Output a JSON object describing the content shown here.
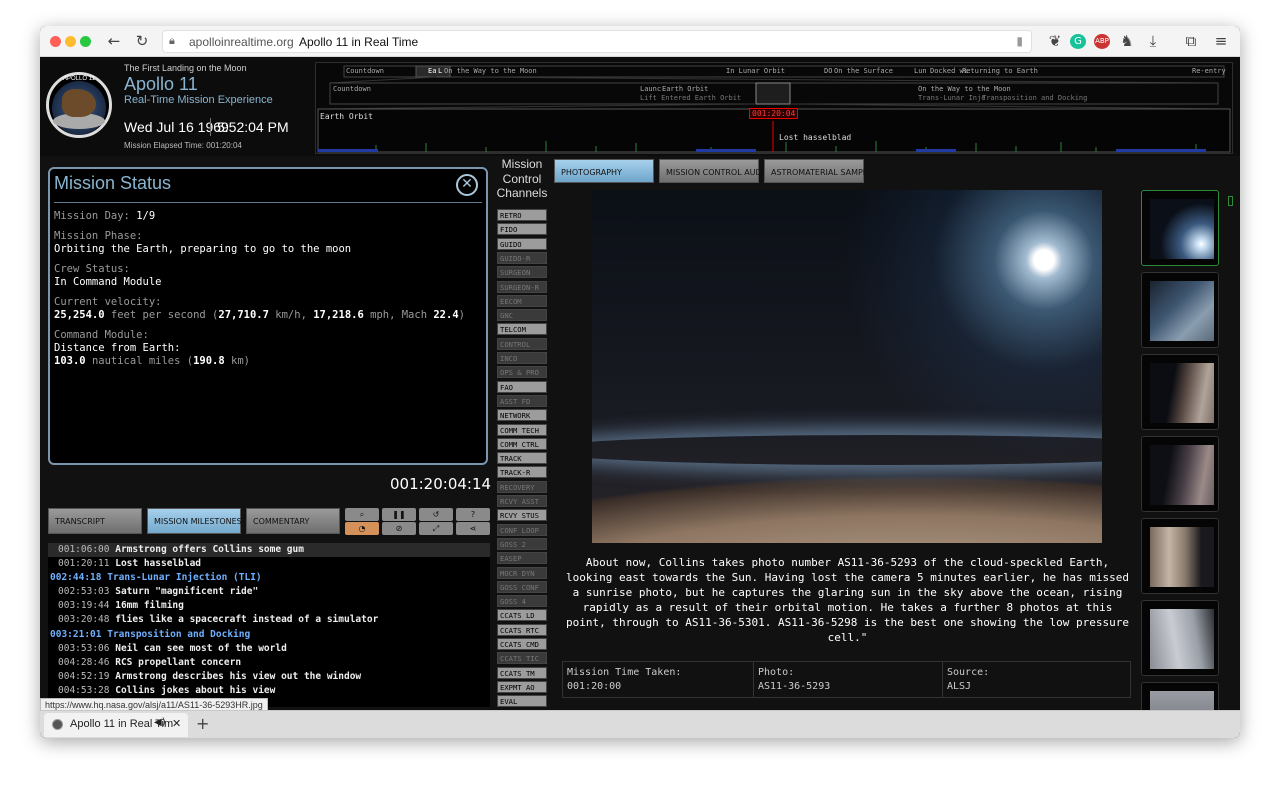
{
  "browser": {
    "domain": "apolloinrealtime.org",
    "page_title": "Apollo 11 in Real Time",
    "tab_title": "Apollo 11 in Real Tim",
    "status_url": "https://www.hq.nasa.gov/alsj/a11/AS11-36-5293HR.jpg",
    "colors": {
      "close": "#fe5f57",
      "minimize": "#febc2e",
      "zoom": "#28c840"
    }
  },
  "header": {
    "subtitle": "The First Landing on the Moon",
    "title": "Apollo 11",
    "tagline": "Real-Time Mission Experience",
    "date": "Wed Jul 16 1969",
    "time": "5:52:04 PM",
    "met_label": "Mission Elapsed Time: 001:20:04",
    "logo_text": "APOLLO 11"
  },
  "timeline": {
    "row1": [
      "Countdown",
      "Ea",
      "L",
      "On the Way to the Moon",
      "In Lunar Orbit",
      "DO",
      "On the Surface",
      "Lun",
      "Docked wi",
      "Returning to Earth",
      "Re-entry"
    ],
    "row2": [
      "Countdown",
      "Launc",
      "Earth Orbit",
      "Lift Entered Earth Orbit",
      "On the Way to the Moon",
      "Trans-Lunar Inje",
      "Transposition and Docking"
    ],
    "row3_label": "Earth Orbit",
    "current": "001:20:04",
    "event": "Lost hasselblad"
  },
  "mission_status": {
    "title": "Mission Status",
    "day_label": "Mission Day:",
    "day_value": "1/9",
    "phase_label": "Mission Phase:",
    "phase_value": "Orbiting the Earth, preparing to go to the moon",
    "crew_label": "Crew Status:",
    "crew_value": "In Command Module",
    "velocity_label": "Current velocity:",
    "vel_fps": "25,254.0",
    "vel_fps_unit": "feet per second (",
    "vel_kmh": "27,710.7",
    "vel_kmh_unit": "km/h,",
    "vel_mph": "17,218.6",
    "vel_mph_unit": "mph, Mach",
    "vel_mach": "22.4",
    "vel_close": ")",
    "cm_label": "Command Module:",
    "dist_label": "Distance from Earth:",
    "dist_nm": "103.0",
    "dist_nm_unit": "nautical miles (",
    "dist_km": "190.8",
    "dist_km_unit": "km)"
  },
  "clock": "001:20:04:14",
  "left_tabs": {
    "transcript": "TRANSCRIPT",
    "milestones": "MISSION MILESTONES",
    "commentary": "COMMENTARY"
  },
  "milestones": [
    {
      "time": "001:06:00",
      "text": "Armstrong offers Collins some gum",
      "key": false
    },
    {
      "time": "001:20:11",
      "text": "Lost hasselblad",
      "key": false
    },
    {
      "time": "002:44:18",
      "text": "Trans-Lunar Injection (TLI)",
      "key": true
    },
    {
      "time": "002:53:03",
      "text": "Saturn \"magnificent ride\"",
      "key": false
    },
    {
      "time": "003:19:44",
      "text": "16mm filming",
      "key": false
    },
    {
      "time": "003:20:48",
      "text": "flies like a spacecraft instead of a simulator",
      "key": false
    },
    {
      "time": "003:21:01",
      "text": "Transposition and Docking",
      "key": true
    },
    {
      "time": "003:53:06",
      "text": "Neil can see most of the world",
      "key": false
    },
    {
      "time": "004:28:46",
      "text": "RCS propellant concern",
      "key": false
    },
    {
      "time": "004:52:19",
      "text": "Armstrong describes his view out the window",
      "key": false
    },
    {
      "time": "004:53:28",
      "text": "Collins jokes about his view",
      "key": false
    }
  ],
  "mcc": {
    "heading": [
      "Mission",
      "Control",
      "Channels"
    ],
    "channels": [
      {
        "name": "RETRO",
        "on": true
      },
      {
        "name": "FIDO",
        "on": true
      },
      {
        "name": "GUIDO",
        "on": true
      },
      {
        "name": "GUIDO-R",
        "on": false
      },
      {
        "name": "SURGEON",
        "on": false
      },
      {
        "name": "SURGEON-R",
        "on": false
      },
      {
        "name": "EECOM",
        "on": false
      },
      {
        "name": "GNC",
        "on": false
      },
      {
        "name": "TELCOM",
        "on": true
      },
      {
        "name": "CONTROL",
        "on": false
      },
      {
        "name": "INCO",
        "on": false
      },
      {
        "name": "OPS & PRO",
        "on": false
      },
      {
        "name": "FAO",
        "on": true
      },
      {
        "name": "ASST FD",
        "on": false
      },
      {
        "name": "NETWORK",
        "on": true
      },
      {
        "name": "COMM TECH",
        "on": true
      },
      {
        "name": "COMM CTRL",
        "on": true
      },
      {
        "name": "TRACK",
        "on": true
      },
      {
        "name": "TRACK-R",
        "on": true
      },
      {
        "name": "RECOVERY",
        "on": false
      },
      {
        "name": "RCVY ASST",
        "on": false
      },
      {
        "name": "RCVY STUS",
        "on": true
      },
      {
        "name": "CONF LOOP",
        "on": false
      },
      {
        "name": "GOSS 2",
        "on": false
      },
      {
        "name": "EASEP",
        "on": false
      },
      {
        "name": "MOCR DYN",
        "on": false
      },
      {
        "name": "GOSS CONF",
        "on": false
      },
      {
        "name": "GOSS 4",
        "on": false
      },
      {
        "name": "CCATS LD",
        "on": true
      },
      {
        "name": "CCATS RTC",
        "on": true
      },
      {
        "name": "CCATS CMD",
        "on": true
      },
      {
        "name": "CCATS TIC",
        "on": false
      },
      {
        "name": "CCATS TM",
        "on": true
      },
      {
        "name": "EXPMT AO",
        "on": true
      },
      {
        "name": "EVAL",
        "on": true
      }
    ]
  },
  "media_tabs": {
    "photography": "PHOTOGRAPHY",
    "audio": "MISSION CONTROL AUDIO",
    "samples": "ASTROMATERIAL SAMPLES"
  },
  "photo": {
    "caption": "About now, Collins takes photo number AS11-36-5293 of the cloud-speckled Earth, looking east towards the Sun. Having lost the camera 5 minutes earlier, he has missed a sunrise photo, but he captures the glaring sun in the sky above the ocean, rising rapidly as a result of their orbital motion. He takes a further 8 photos at this point, through to AS11-36-5301. AS11-36-5298 is the best one showing the low pressure cell.\"",
    "mission_time_label": "Mission Time Taken:",
    "mission_time": "001:20:00",
    "photo_label": "Photo:",
    "photo_id": "AS11-36-5293",
    "source_label": "Source:",
    "source": "ALSJ"
  }
}
